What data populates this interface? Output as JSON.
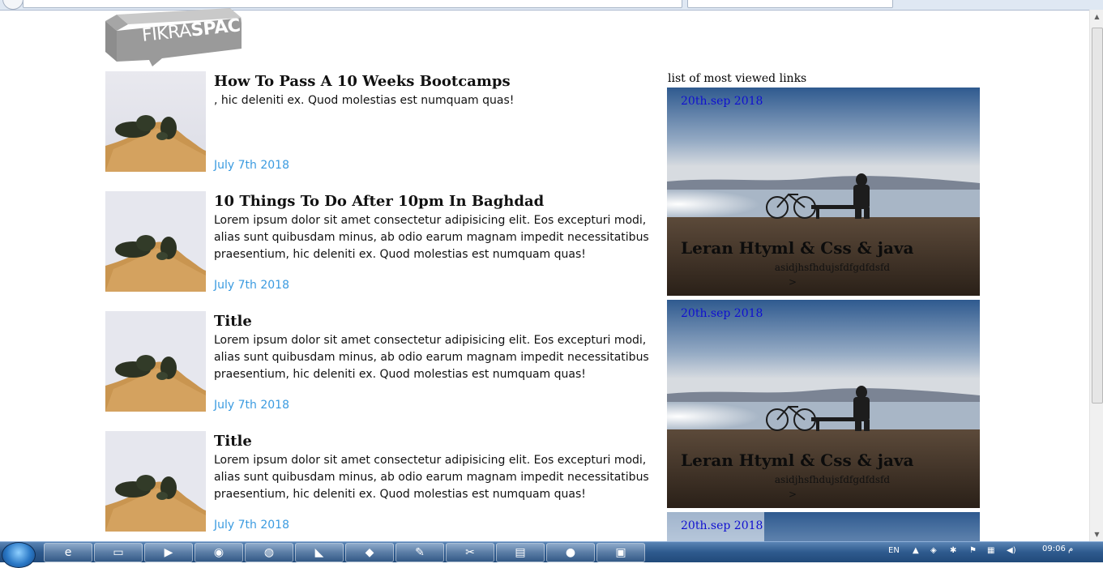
{
  "logo": {
    "part1": "FIKRA",
    "part2": "SPACE"
  },
  "articles": [
    {
      "title": "How To Pass A 10 Weeks Bootcamps",
      "text": ", hic deleniti ex. Quod molestias est numquam quas!",
      "date": "July 7th 2018"
    },
    {
      "title": "10 Things To Do After 10pm In Baghdad",
      "text": "Lorem ipsum dolor sit amet consectetur adipisicing elit. Eos excepturi modi, alias sunt quibusdam minus, ab odio earum magnam impedit necessitatibus praesentium, hic deleniti ex. Quod molestias est numquam quas!",
      "date": "July 7th 2018"
    },
    {
      "title": "Title",
      "text": "Lorem ipsum dolor sit amet consectetur adipisicing elit. Eos excepturi modi, alias sunt quibusdam minus, ab odio earum magnam impedit necessitatibus praesentium, hic deleniti ex. Quod molestias est numquam quas!",
      "date": "July 7th 2018"
    },
    {
      "title": "Title",
      "text": "Lorem ipsum dolor sit amet consectetur adipisicing elit. Eos excepturi modi, alias sunt quibusdam minus, ab odio earum magnam impedit necessitatibus praesentium, hic deleniti ex. Quod molestias est numquam quas!",
      "date": "July 7th 2018"
    }
  ],
  "sidebar": {
    "heading": "list of most viewed links",
    "cards": [
      {
        "date": "20th.sep 2018",
        "title": "Leran Htyml & Css & java",
        "subtitle": "asidjhsfhdujsfdfgdfdsfd",
        "more": ">"
      },
      {
        "date": "20th.sep 2018",
        "title": "Leran Htyml & Css & java",
        "subtitle": "asidjhsfhdujsfdfgdfdsfd",
        "more": ">"
      },
      {
        "date": "20th.sep 2018"
      }
    ]
  },
  "taskbar": {
    "language": "EN",
    "clock": "09:06 م"
  },
  "colors": {
    "date_link": "#3b9be0",
    "card_date": "#1010d0",
    "taskbar": "#2e5a8e"
  }
}
